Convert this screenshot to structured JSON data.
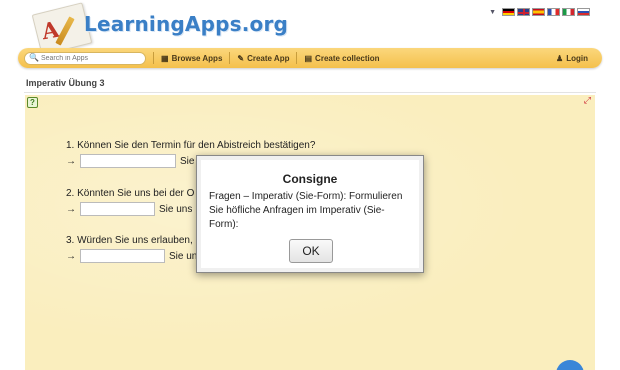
{
  "header": {
    "logo_text": "LearningApps.org",
    "language_flags": [
      "de",
      "en",
      "es",
      "fr",
      "it",
      "ru"
    ]
  },
  "navbar": {
    "search_placeholder": "Search in Apps",
    "items": [
      {
        "label": "Browse Apps",
        "icon": "grid-icon"
      },
      {
        "label": "Create App",
        "icon": "pencil-icon"
      },
      {
        "label": "Create collection",
        "icon": "collection-icon"
      }
    ],
    "login_label": "Login",
    "login_icon": "user-icon"
  },
  "page": {
    "title": "Imperativ Übung 3"
  },
  "exercise": {
    "questions": [
      {
        "text": "1. Können Sie den Termin für den Abistreich bestätigen?",
        "arrow": "→",
        "suffix": "Sie"
      },
      {
        "text": "2. Könnten Sie uns bei der O",
        "arrow": "→",
        "suffix": "Sie uns"
      },
      {
        "text": "3. Würden Sie uns erlauben,",
        "arrow": "→",
        "suffix": "Sie un"
      }
    ]
  },
  "modal": {
    "title": "Consigne",
    "text": "Fragen – Imperativ (Sie-Form): Formulieren Sie höfliche Anfragen im Imperativ (Sie-Form):",
    "ok_label": "OK"
  },
  "colors": {
    "navbar": "#f4c04c",
    "app_background": "#faeebe",
    "logo_text": "#3a7fc6"
  }
}
